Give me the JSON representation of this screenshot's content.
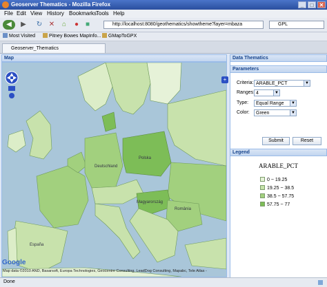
{
  "window": {
    "title": "Geoserver Thematics - Mozilla Firefox"
  },
  "menu": [
    "File",
    "Edit",
    "View",
    "History",
    "Bookmarks",
    "Tools",
    "Help"
  ],
  "navigation": {
    "url": "http://localhost:8080/geothematics/showtheme?layer=mbaza",
    "search_value": "GPL"
  },
  "bookmarks": [
    "Most Visited",
    "Pitney Bowes MapInfo...",
    "GMapToGPX"
  ],
  "tab": {
    "label": "Geoserver_Thematics"
  },
  "map_panel": {
    "title": "Map",
    "attribution": "Map data ©2010 AND, Basarsoft, Europa Technologies, Geocentre Consulting, LeadDog Consulting, Mapabc, Tele Atlas -",
    "google_logo": "Google",
    "countries": [
      "Deutschland",
      "Polska",
      "România",
      "Magyarország",
      "España"
    ]
  },
  "thematics_panel": {
    "title": "Data Thematics",
    "parameters_title": "Parameters",
    "criteria_label": "Criteria:",
    "criteria_value": "ARABLE_PCT",
    "ranges_label": "Ranges:",
    "ranges_value": "4",
    "type_label": "Type:",
    "type_value": "Equal Range",
    "color_label": "Color:",
    "color_value": "Green",
    "submit_label": "Submit",
    "reset_label": "Reset"
  },
  "legend": {
    "title": "Legend",
    "heading": "ARABLE_PCT",
    "items": [
      {
        "label": "0 ~ 19.25",
        "color": "#e6f2d8"
      },
      {
        "label": "19.25 ~ 38.5",
        "color": "#c6e3aa"
      },
      {
        "label": "38.5 ~ 57.75",
        "color": "#a2d07e"
      },
      {
        "label": "57.75 ~ 77",
        "color": "#7dbd57"
      }
    ]
  },
  "status": {
    "text": "Done"
  }
}
